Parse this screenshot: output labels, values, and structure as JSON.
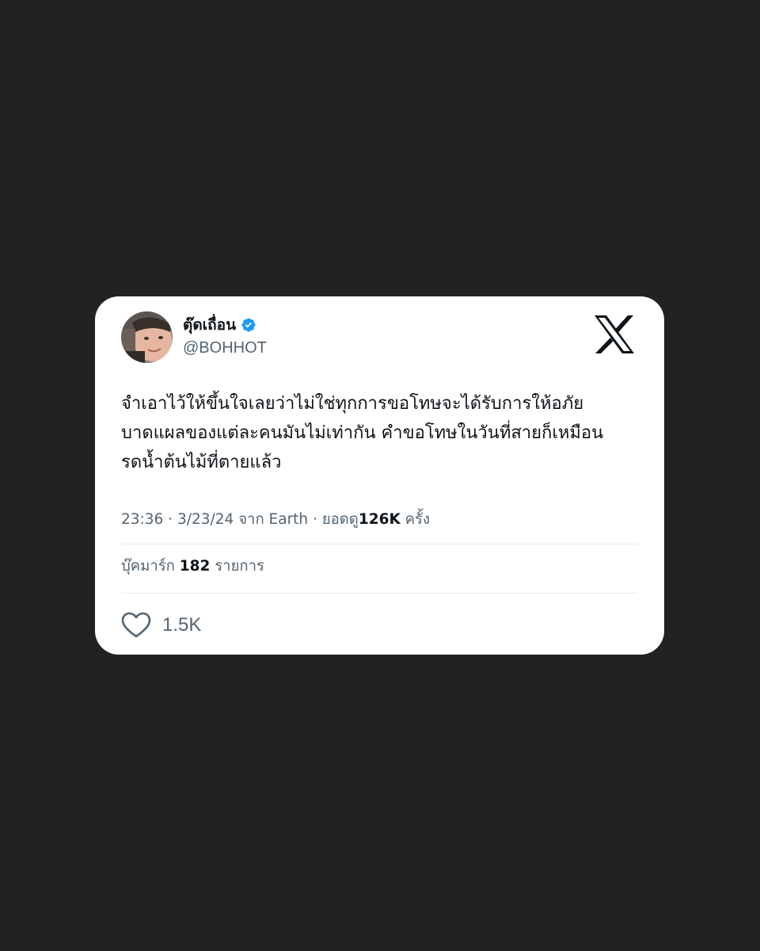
{
  "tweet": {
    "author": {
      "display_name": "ตุ๊ดเถื่อน",
      "handle": "@BOHHOT",
      "verified": true,
      "avatar_icon": "profile-photo"
    },
    "platform_logo_icon": "x-logo-icon",
    "text": "จำเอาไว้ให้ขึ้นใจเลยว่าไม่ใช่ทุกการขอโทษจะได้รับการให้อภัย\nบาดแผลของแต่ละคนมันไม่เท่ากัน คำขอโทษในวันที่สายก็เหมือน\nรดน้ำต้นไม้ที่ตายแล้ว",
    "meta": {
      "time": "23:36",
      "separator_1": "·",
      "date": "3/23/24",
      "source_prefix": "จาก",
      "source": "Earth",
      "separator_2": "·",
      "views_prefix": "ยอดดู",
      "views_count": "126K",
      "views_suffix": "ครั้ง"
    },
    "bookmarks": {
      "prefix": "บุ๊คมาร์ก",
      "count": "182",
      "suffix": "รายการ"
    },
    "likes": {
      "icon": "heart-icon",
      "count": "1.5K"
    }
  },
  "colors": {
    "background": "#222222",
    "card": "#ffffff",
    "text_primary": "#0f1419",
    "text_secondary": "#536471",
    "verified_badge": "#1d9bf0",
    "divider": "#e6e9eb"
  }
}
